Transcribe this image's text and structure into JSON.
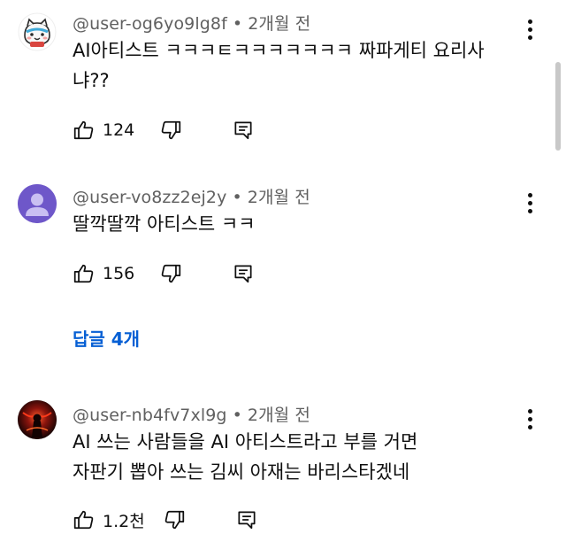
{
  "comments": [
    {
      "author": "@user-og6yo9lg8f",
      "time": "2개월 전",
      "text_lines": [
        "AI아티스트 ㅋㅋㅋㅌㅋㅋㅋㅋㅋㅋㅋ 짜파게티 요리사",
        "냐??"
      ],
      "likes": "124"
    },
    {
      "author": "@user-vo8zz2ej2y",
      "time": "2개월 전",
      "text_lines": [
        "딸깍딸깍 아티스트 ㅋㅋ"
      ],
      "likes": "156",
      "replies_label": "답글 4개"
    },
    {
      "author": "@user-nb4fv7xl9g",
      "time": "2개월 전",
      "text_lines": [
        "AI 쓰는 사람들을 AI 아티스트라고 부를 거면",
        "자판기 뽑아 쓰는 김씨 아재는 바리스타겠네"
      ],
      "likes": "1.2천"
    }
  ],
  "dot_separator": "•",
  "colors": {
    "link_blue": "#065fd4",
    "meta_gray": "#606060",
    "text": "#0f0f0f",
    "avatar_purple": "#6e57c9",
    "avatar_dark": "#1a0606",
    "avatar_red": "#d1271f"
  },
  "icons": [
    "avatar-cat-icon",
    "avatar-default-user-icon",
    "avatar-dark-figure-icon",
    "thumbs-up-icon",
    "thumbs-down-icon",
    "reply-comment-icon",
    "more-vert-icon"
  ]
}
